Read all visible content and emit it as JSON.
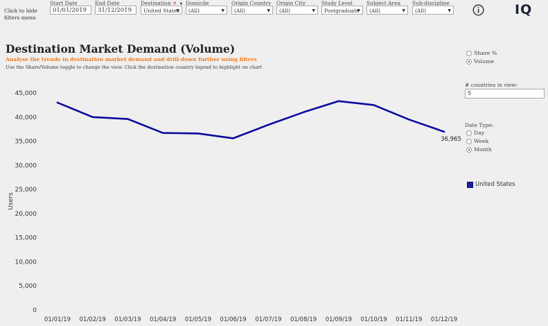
{
  "filters": {
    "hide_label": "Click to hide filters menu",
    "items": [
      {
        "label": "Start Date",
        "value": "01/01/2019",
        "kind": "input"
      },
      {
        "label": "End Date",
        "value": "31/12/2019",
        "kind": "input"
      },
      {
        "label": "Destination",
        "value": "United States",
        "kind": "select"
      },
      {
        "label": "Domicile",
        "value": "(All)",
        "kind": "select"
      },
      {
        "label": "Origin Country",
        "value": "(All)",
        "kind": "select"
      },
      {
        "label": "Origin City",
        "value": "(All)",
        "kind": "select"
      },
      {
        "label": "Study Level",
        "value": "Postgraduate",
        "kind": "select"
      },
      {
        "label": "Subject Area",
        "value": "(All)",
        "kind": "select"
      },
      {
        "label": "Sub-discipline",
        "value": "(All)",
        "kind": "select"
      }
    ],
    "caret_glyph": "▼"
  },
  "header": {
    "info_icon": "info-icon",
    "logo_text": "IQ"
  },
  "main": {
    "title": "Destination Market Demand (Volume)",
    "subtitle": "Analyse the trends in destination market demand and drill-down further using filters",
    "instruction": "Use the Share/Volume toggle to change the view. Click the destination country legend to highlight on chart"
  },
  "controls": {
    "view_options": [
      {
        "label": "Share %",
        "selected": false
      },
      {
        "label": "Volume",
        "selected": true
      }
    ],
    "countries_label": "# countries in view:",
    "countries_value": "5",
    "date_type_label": "Date Type:",
    "date_type_options": [
      {
        "label": "Day",
        "selected": false
      },
      {
        "label": "Week",
        "selected": false
      },
      {
        "label": "Month",
        "selected": true
      }
    ]
  },
  "colors": {
    "accent_orange": "#f07c1f",
    "series_blue": "#0a0a9e"
  },
  "chart_data": {
    "type": "line",
    "title": "",
    "xlabel": "",
    "ylabel": "Users",
    "ylim": [
      0,
      45000
    ],
    "y_ticks": [
      "0",
      "5,000",
      "10,000",
      "15,000",
      "20,000",
      "25,000",
      "30,000",
      "35,000",
      "40,000",
      "45,000"
    ],
    "categories": [
      "01/01/19",
      "01/02/19",
      "01/03/19",
      "01/04/19",
      "01/05/19",
      "01/06/19",
      "01/07/19",
      "01/08/19",
      "01/09/19",
      "01/10/19",
      "01/11/19",
      "01/12/19"
    ],
    "series": [
      {
        "name": "United States",
        "values": [
          43000,
          40000,
          39600,
          36700,
          36600,
          35600,
          38400,
          41000,
          43300,
          42500,
          39500,
          36965
        ]
      }
    ],
    "end_label": "36,965",
    "legend": "right",
    "grid": false
  }
}
